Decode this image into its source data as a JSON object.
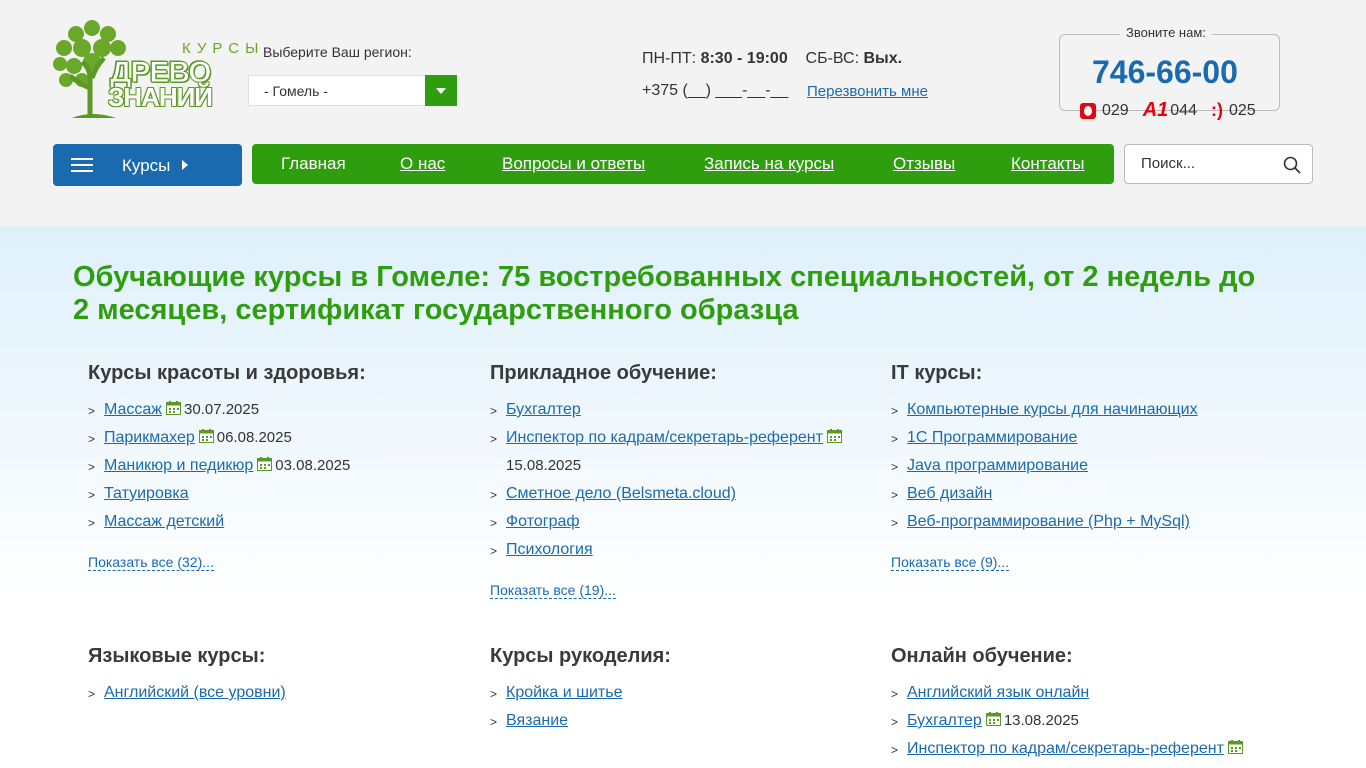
{
  "logo": {
    "top": "КУРСЫ",
    "word1": "ДРЕВО",
    "word2": "ЗНАНИЙ"
  },
  "region": {
    "label": "Выберите Ваш регион:",
    "selected": "- Гомель -"
  },
  "hours": {
    "weekday_label": "ПН-ПТ:",
    "weekday_time": "8:30 - 19:00",
    "weekend_label": "СБ-ВС:",
    "weekend_time": "Вых."
  },
  "callback": {
    "phone_mask": "+375 (__) ___-__-__",
    "link": "Перезвонить мне"
  },
  "call_box": {
    "label": "Звоните нам:",
    "phone": "746-66-00",
    "operators": [
      {
        "icon": "mts-icon",
        "code": "029"
      },
      {
        "icon": "a1-icon",
        "code": "044"
      },
      {
        "icon": "life-icon",
        "code": "025"
      }
    ]
  },
  "courses_button": {
    "label": "Курсы"
  },
  "nav": {
    "items": [
      {
        "label": "Главная"
      },
      {
        "label": "О нас"
      },
      {
        "label": "Вопросы и ответы"
      },
      {
        "label": "Запись на курсы"
      },
      {
        "label": "Отзывы"
      },
      {
        "label": "Контакты"
      }
    ]
  },
  "search": {
    "placeholder": "Поиск..."
  },
  "headline": {
    "bold": "Обучающие курсы в Гомеле:",
    "rest": " 75 востребованных специальностей, от 2 недель до 2 месяцев, сертификат государственного образца"
  },
  "sections": [
    {
      "title": "Курсы красоты и здоровья:",
      "items": [
        {
          "label": "Массаж",
          "date": "30.07.2025"
        },
        {
          "label": "Парикмахер",
          "date": "06.08.2025"
        },
        {
          "label": "Маникюр и педикюр",
          "date": "03.08.2025"
        },
        {
          "label": "Татуировка",
          "date": ""
        },
        {
          "label": "Массаж детский",
          "date": ""
        }
      ],
      "show_all": "Показать все (32)..."
    },
    {
      "title": "Прикладное обучение:",
      "items": [
        {
          "label": "Бухгалтер",
          "date": ""
        },
        {
          "label": "Инспектор по кадрам/секретарь-референт",
          "date": "15.08.2025"
        },
        {
          "label": "Сметное дело (Belsmeta.cloud)",
          "date": ""
        },
        {
          "label": "Фотограф",
          "date": ""
        },
        {
          "label": "Психология",
          "date": ""
        }
      ],
      "show_all": "Показать все (19)..."
    },
    {
      "title": "IT курсы:",
      "items": [
        {
          "label": "Компьютерные курсы для начинающих",
          "date": ""
        },
        {
          "label": "1С Программирование",
          "date": ""
        },
        {
          "label": "Java программирование",
          "date": ""
        },
        {
          "label": "Веб дизайн",
          "date": ""
        },
        {
          "label": "Веб-программирование (Php + MySql)",
          "date": ""
        }
      ],
      "show_all": "Показать все (9)..."
    },
    {
      "title": "Языковые курсы:",
      "items": [
        {
          "label": "Английский (все уровни)",
          "date": ""
        }
      ]
    },
    {
      "title": "Курсы рукоделия:",
      "items": [
        {
          "label": "Кройка и шитье",
          "date": ""
        },
        {
          "label": "Вязание",
          "date": ""
        }
      ]
    },
    {
      "title": "Онлайн обучение:",
      "items": [
        {
          "label": "Английский язык онлайн",
          "date": ""
        },
        {
          "label": "Бухгалтер",
          "date": "13.08.2025"
        },
        {
          "label": "Инспектор по кадрам/секретарь-референт",
          "date": ""
        }
      ]
    }
  ],
  "colors": {
    "green": "#2e9e0e",
    "blue": "#1a6ab0",
    "header_bg": "#f3f3f3",
    "main_bg_top": "#dff0fb"
  },
  "icons": {
    "calendar": "calendar-icon",
    "search": "search-icon",
    "menu": "burger-menu-icon"
  }
}
